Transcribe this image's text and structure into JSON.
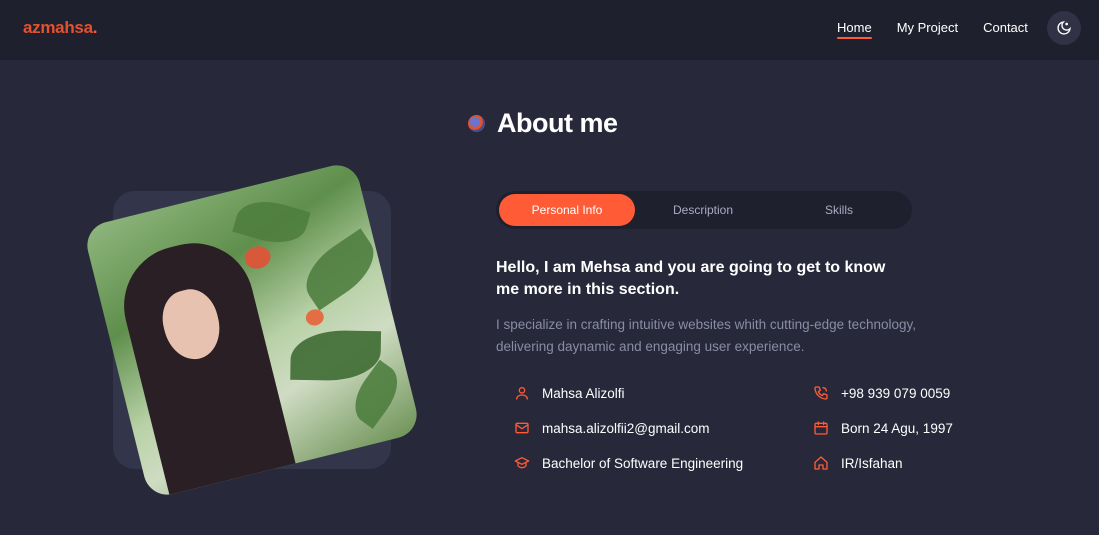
{
  "navbar": {
    "logo": "azmahsa",
    "logo_dot": ".",
    "links": [
      {
        "label": "Home",
        "active": true
      },
      {
        "label": "My Project",
        "active": false
      },
      {
        "label": "Contact",
        "active": false
      }
    ],
    "theme_toggle_icon": "moon-icon"
  },
  "about": {
    "title": "About me",
    "tabs": [
      "Personal Info",
      "Description",
      "Skills"
    ],
    "active_tab": "Personal Info",
    "headline": "Hello, I am Mehsa and you are going to get to know me more in this section.",
    "description": "I specialize in crafting intuitive websites whith cutting-edge technology, delivering daynamic and engaging user experience.",
    "info": {
      "name": "Mahsa Alizolfi",
      "email": "mahsa.alizolfii2@gmail.com",
      "education": "Bachelor of Software Engineering",
      "phone": "+98 939 079 0059",
      "birth": "Born 24 Agu, 1997",
      "location": "IR/Isfahan"
    }
  },
  "colors": {
    "accent": "#ff5b36",
    "background": "#272839",
    "navbar": "#1f202d"
  }
}
